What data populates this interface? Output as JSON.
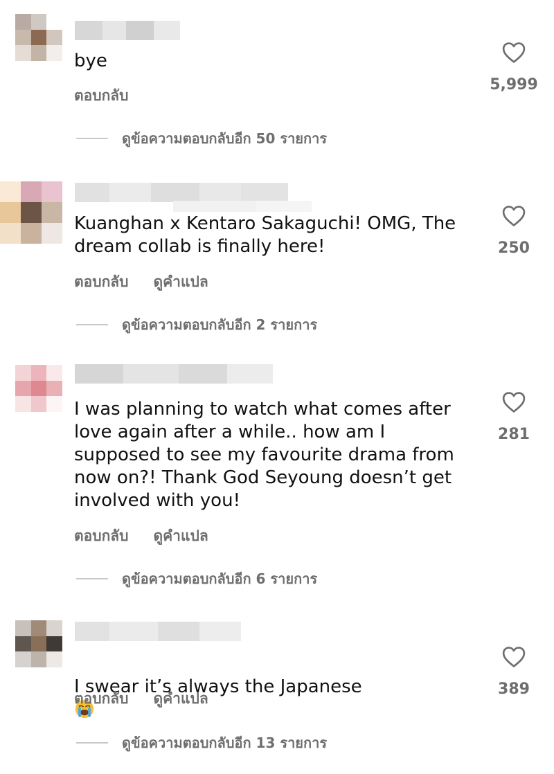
{
  "comments": [
    {
      "text": "bye",
      "actions": {
        "reply": "ตอบกลับ"
      },
      "likes": "5,999",
      "view_replies": "ดูข้อความตอบกลับอีก 50 รายการ"
    },
    {
      "text": "Kuanghan x Kentaro Sakaguchi! OMG, The\ndream collab is finally here!",
      "actions": {
        "reply": "ตอบกลับ",
        "translate": "ดูคำแปล"
      },
      "likes": "250",
      "view_replies": "ดูข้อความตอบกลับอีก 2 รายการ"
    },
    {
      "text": "I was planning to watch what comes after\nlove again after a while.. how am I\nsupposed to see my favourite drama from\nnow on?! Thank God Seyoung doesn’t get\ninvolved with you!",
      "actions": {
        "reply": "ตอบกลับ",
        "translate": "ดูคำแปล"
      },
      "likes": "281",
      "view_replies": "ดูข้อความตอบกลับอีก 6 รายการ"
    },
    {
      "text": "I swear it’s always the Japanese",
      "emoji": "loudly-crying-face",
      "actions": {
        "reply": "ตอบกลับ",
        "translate": "ดูคำแปล"
      },
      "likes": "389",
      "view_replies": "ดูข้อความตอบกลับอีก 13 รายการ"
    }
  ],
  "colors": {
    "text": "#111111",
    "secondary": "#6e6e6e",
    "divider": "#c9c9c9"
  }
}
